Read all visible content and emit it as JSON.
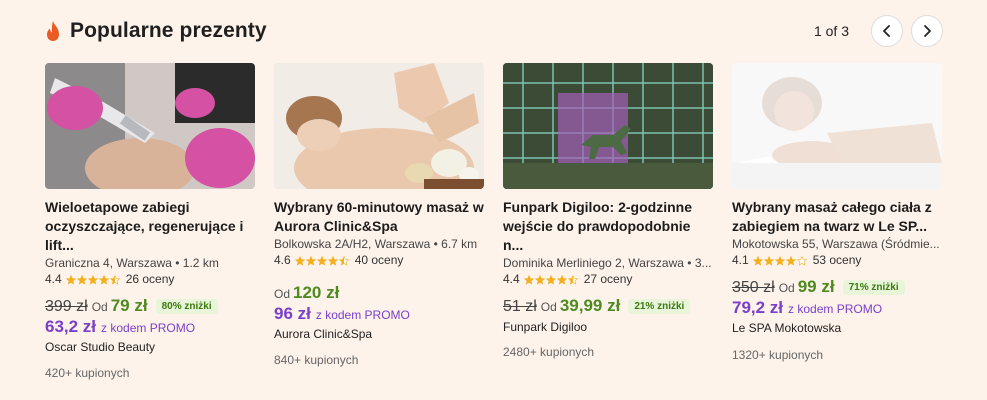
{
  "header": {
    "title": "Popularne prezenty",
    "page_indicator": "1 of 3"
  },
  "colors": {
    "accent_green": "#4d8a1f",
    "promo_purple": "#7b3fc9",
    "flame": "#ea5a24",
    "star": "#f2b01e"
  },
  "cards": [
    {
      "name": "Wieloetapowe zabiegi oczyszczające, regenerujące i lift...",
      "address": "Graniczna 4, Warszawa • 1.2 km",
      "rating": "4.4",
      "stars": 4.5,
      "reviews": "26 oceny",
      "old_price": "399 zł",
      "od": "Od",
      "price": "79 zł",
      "discount": "80% zniżki",
      "promo_price": "63,2 zł",
      "promo_code": "z kodem PROMO",
      "merchant": "Oscar Studio Beauty",
      "sold": "420+ kupionych"
    },
    {
      "name": "Wybrany 60-minutowy masaż w Aurora Clinic&Spa",
      "address": "Bolkowska 2A/H2, Warszawa • 6.7 km",
      "rating": "4.6",
      "stars": 4.5,
      "reviews": "40 oceny",
      "old_price": "",
      "od": "Od",
      "price": "120 zł",
      "discount": "",
      "promo_price": "96 zł",
      "promo_code": "z kodem PROMO",
      "merchant": "Aurora Clinic&Spa",
      "sold": "840+ kupionych"
    },
    {
      "name": "Funpark Digiloo: 2-godzinne wejście do prawdopodobnie n...",
      "address": "Dominika Merliniego 2, Warszawa • 3...",
      "rating": "4.4",
      "stars": 4.5,
      "reviews": "27 oceny",
      "old_price": "51 zł",
      "od": "Od",
      "price": "39,99 zł",
      "discount": "21% zniżki",
      "promo_price": "",
      "promo_code": "",
      "merchant": "Funpark Digiloo",
      "sold": "2480+ kupionych"
    },
    {
      "name": "Wybrany masaż całego ciała z zabiegiem na twarz w Le SP...",
      "address": "Mokotowska 55, Warszawa (Śródmie...",
      "rating": "4.1",
      "stars": 4,
      "reviews": "53 oceny",
      "old_price": "350 zł",
      "od": "Od",
      "price": "99 zł",
      "discount": "71% zniżki",
      "promo_price": "79,2 zł",
      "promo_code": "z kodem PROMO",
      "merchant": "Le SPA Mokotowska",
      "sold": "1320+ kupionych"
    }
  ]
}
